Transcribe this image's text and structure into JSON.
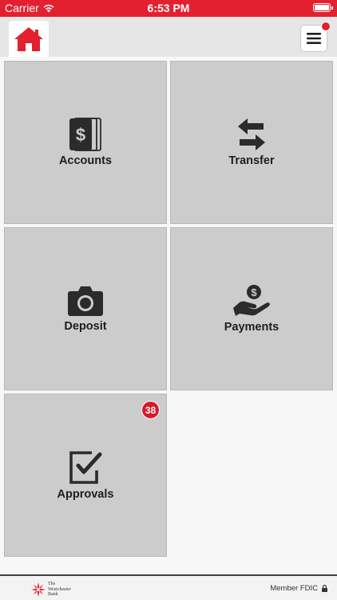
{
  "status_bar": {
    "carrier": "Carrier",
    "time": "6:53 PM"
  },
  "nav": {
    "home_icon": "home-icon",
    "menu_icon": "hamburger-icon",
    "menu_notification": true
  },
  "tiles": [
    {
      "label": "Accounts",
      "icon": "accounts-icon"
    },
    {
      "label": "Transfer",
      "icon": "transfer-icon"
    },
    {
      "label": "Deposit",
      "icon": "camera-icon"
    },
    {
      "label": "Payments",
      "icon": "payments-icon"
    },
    {
      "label": "Approvals",
      "icon": "approvals-icon",
      "badge": "38"
    }
  ],
  "footer": {
    "bank_name": "The Westchester Bank",
    "bank_name_lines": [
      "The",
      "Westchester",
      "Bank"
    ],
    "fdic": "Member FDIC"
  },
  "colors": {
    "brand_red": "#e3202f",
    "tile_gray": "#cccccc",
    "icon_dark": "#2b2b2b"
  }
}
